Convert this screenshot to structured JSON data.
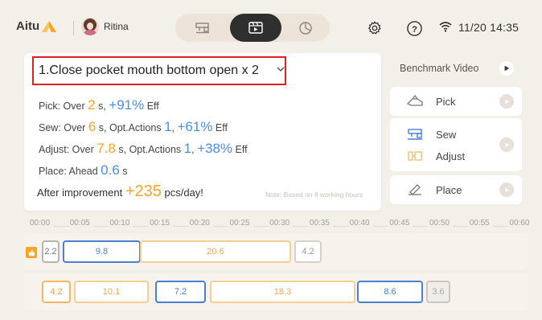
{
  "header": {
    "logo_text": "Aitu",
    "user_name": "Ritina",
    "tabs": [
      {
        "name": "machine",
        "icon": "sewing-machine-icon",
        "active": false
      },
      {
        "name": "video",
        "icon": "video-player-icon",
        "active": true
      },
      {
        "name": "stats",
        "icon": "pie-chart-icon",
        "active": false
      }
    ],
    "datetime": "11/20 14:35"
  },
  "main": {
    "title": "1.Close pocket mouth bottom open x 2",
    "pick": {
      "prefix": "Pick: Over ",
      "sec": "2",
      "sec_unit": " s, ",
      "pct": "+91%",
      "suffix": " Eff"
    },
    "sew": {
      "prefix": "Sew: Over ",
      "sec": "6",
      "sec_unit": " s, ",
      "opt_label": "Opt.Actions ",
      "opt": "1",
      "sep": ", ",
      "pct": "+61%",
      "suffix": " Eff"
    },
    "adjust": {
      "prefix": "Adjust: Over ",
      "sec": "7.8",
      "sec_unit": " s, ",
      "opt_label": "Opt.Actions ",
      "opt": "1",
      "sep": ", ",
      "pct": "+38%",
      "suffix": " Eff"
    },
    "place": {
      "prefix": "Place: Ahead ",
      "sec": "0.6",
      "sec_unit": " s"
    },
    "improve": {
      "prefix": "After improvement ",
      "value": "+235",
      "suffix": " pcs/day!"
    },
    "note": "Note: Based on 8 working hours"
  },
  "benchmark": {
    "title": "Benchmark Video",
    "items": {
      "pick": "Pick",
      "sew": "Sew",
      "adjust": "Adjust",
      "place": "Place"
    }
  },
  "timeline": {
    "ticks": [
      "00:00",
      "00:05",
      "00:10",
      "00:15",
      "00:20",
      "00:25",
      "00:30",
      "00:35",
      "00:40",
      "00:45",
      "00:50",
      "00:55",
      "00:60"
    ],
    "row1": [
      {
        "label": "2.2",
        "type": "gray"
      },
      {
        "label": "9.8",
        "type": "blue"
      },
      {
        "label": "20.6",
        "type": "orange"
      },
      {
        "label": "4.2",
        "type": "grayl"
      }
    ],
    "row2": [
      {
        "label": "4.2",
        "type": "orange-strong"
      },
      {
        "label": "10.1",
        "type": "orange"
      },
      {
        "label": "7.2",
        "type": "blue"
      },
      {
        "label": "18.3",
        "type": "orange"
      },
      {
        "label": "8.6",
        "type": "blue"
      },
      {
        "label": "3.6",
        "type": "gfill"
      }
    ]
  },
  "colors": {
    "accent_orange": "#f5a623",
    "accent_blue": "#4a8fe8",
    "highlight_red": "#e02020"
  }
}
